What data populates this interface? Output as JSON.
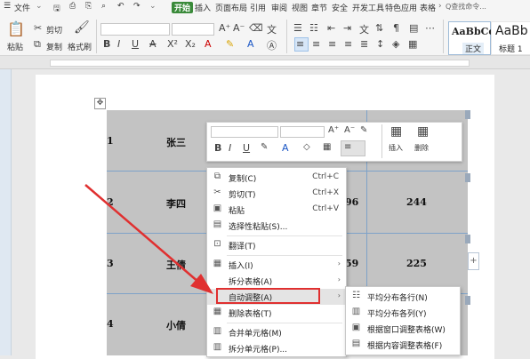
{
  "menubar": {
    "file": "文件",
    "tabs": [
      "开始",
      "插入",
      "页面布局",
      "引用",
      "审阅",
      "视图",
      "章节",
      "安全",
      "开发工具",
      "特色应用",
      "表格"
    ],
    "search": "Q查找命令..."
  },
  "ribbon": {
    "paste": "粘贴",
    "cut": "剪切",
    "copy": "复制",
    "format_painter": "格式刷",
    "bold": "B",
    "italic": "I",
    "underline": "U",
    "strike": "A",
    "style1_preview": "AaBbCc",
    "style1_name": "正文",
    "style2_preview": "AaBb",
    "style2_name": "标题 1"
  },
  "table": {
    "rows": [
      {
        "num": "1",
        "name": "张三",
        "v1": "",
        "v2": ""
      },
      {
        "num": "2",
        "name": "李四",
        "v1": "96",
        "v2": "244"
      },
      {
        "num": "3",
        "name": "王倩",
        "v1": "59",
        "v2": "225"
      },
      {
        "num": "4",
        "name": "小倩",
        "v1": "",
        "v2": ""
      }
    ]
  },
  "mini_toolbar": {
    "bold": "B",
    "italic": "I",
    "underline": "U",
    "insert": "插入",
    "delete": "删除"
  },
  "context_menu": {
    "items": [
      {
        "label": "复制(C)",
        "shortcut": "Ctrl+C",
        "icon": "copy-icon"
      },
      {
        "label": "剪切(T)",
        "shortcut": "Ctrl+X",
        "icon": "scissors-icon"
      },
      {
        "label": "粘贴",
        "shortcut": "Ctrl+V",
        "icon": "paste-icon"
      },
      {
        "label": "选择性粘贴(S)...",
        "shortcut": "",
        "icon": "paste-special-icon"
      },
      {
        "label": "翻译(T)",
        "shortcut": "",
        "icon": "translate-icon"
      },
      {
        "label": "插入(I)",
        "shortcut": "",
        "icon": "table-insert-icon"
      },
      {
        "label": "拆分表格(A)",
        "shortcut": "",
        "icon": ""
      },
      {
        "label": "自动调整(A)",
        "shortcut": "",
        "icon": ""
      },
      {
        "label": "删除表格(T)",
        "shortcut": "",
        "icon": "table-delete-icon"
      },
      {
        "label": "合并单元格(M)",
        "shortcut": "",
        "icon": "merge-cells-icon"
      },
      {
        "label": "拆分单元格(P)...",
        "shortcut": "",
        "icon": "split-cells-icon"
      }
    ]
  },
  "submenu": {
    "items": [
      {
        "label": "平均分布各行(N)"
      },
      {
        "label": "平均分布各列(Y)"
      },
      {
        "label": "根据窗口调整表格(W)"
      },
      {
        "label": "根据内容调整表格(F)"
      }
    ]
  },
  "colors": {
    "accent_green": "#3a8a3a",
    "annotation_red": "#e03030",
    "table_gray": "#c3c3c3"
  }
}
